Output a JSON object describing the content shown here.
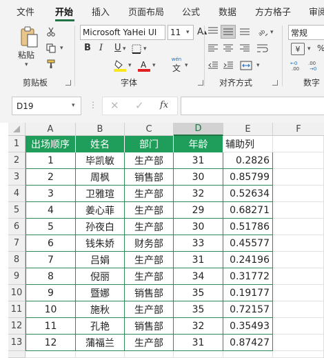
{
  "menu": {
    "tabs": [
      "文件",
      "开始",
      "插入",
      "页面布局",
      "公式",
      "数据",
      "方方格子",
      "审阅"
    ],
    "active": "开始"
  },
  "ribbon": {
    "paste_label": "粘贴",
    "clipboard_label": "剪贴板",
    "font_label": "字体",
    "align_label": "对齐方式",
    "number_label": "数字",
    "font_name": "Microsoft YaHei UI",
    "font_size": "11",
    "number_format": "常规",
    "bold": "B",
    "italic": "I",
    "underline": "U",
    "wen_label": "wén",
    "wen_char": "文",
    "currency": "¥",
    "fill_color": "#f7e71c",
    "font_color": "#e02020",
    "accent": "#217346"
  },
  "formula_bar": {
    "name_box": "D19",
    "fx": "fx",
    "formula": ""
  },
  "sheet": {
    "columns": [
      "A",
      "B",
      "C",
      "D",
      "E",
      "F"
    ],
    "selected_column": "D",
    "row_numbers": [
      "1",
      "2",
      "3",
      "4",
      "5",
      "6",
      "7",
      "8",
      "9",
      "10",
      "11",
      "12",
      "13"
    ],
    "header": [
      "出场顺序",
      "姓名",
      "部门",
      "年龄",
      "辅助列"
    ],
    "header_color": "#1f9e5b",
    "border_color": "#2e8b57",
    "rows": [
      [
        "1",
        "毕凯敏",
        "生产部",
        "31",
        "0.2826"
      ],
      [
        "2",
        "周枫",
        "销售部",
        "30",
        "0.85799"
      ],
      [
        "3",
        "卫雅瑄",
        "生产部",
        "32",
        "0.52634"
      ],
      [
        "4",
        "姜心菲",
        "生产部",
        "29",
        "0.68271"
      ],
      [
        "5",
        "孙夜白",
        "生产部",
        "30",
        "0.51786"
      ],
      [
        "6",
        "钱朱娇",
        "财务部",
        "33",
        "0.45577"
      ],
      [
        "7",
        "吕娟",
        "生产部",
        "31",
        "0.24196"
      ],
      [
        "8",
        "倪丽",
        "生产部",
        "34",
        "0.31772"
      ],
      [
        "9",
        "暨娜",
        "销售部",
        "35",
        "0.19177"
      ],
      [
        "10",
        "施秋",
        "生产部",
        "35",
        "0.72157"
      ],
      [
        "11",
        "孔艳",
        "销售部",
        "32",
        "0.35493"
      ],
      [
        "12",
        "蒲福兰",
        "生产部",
        "31",
        "0.87427"
      ]
    ]
  }
}
